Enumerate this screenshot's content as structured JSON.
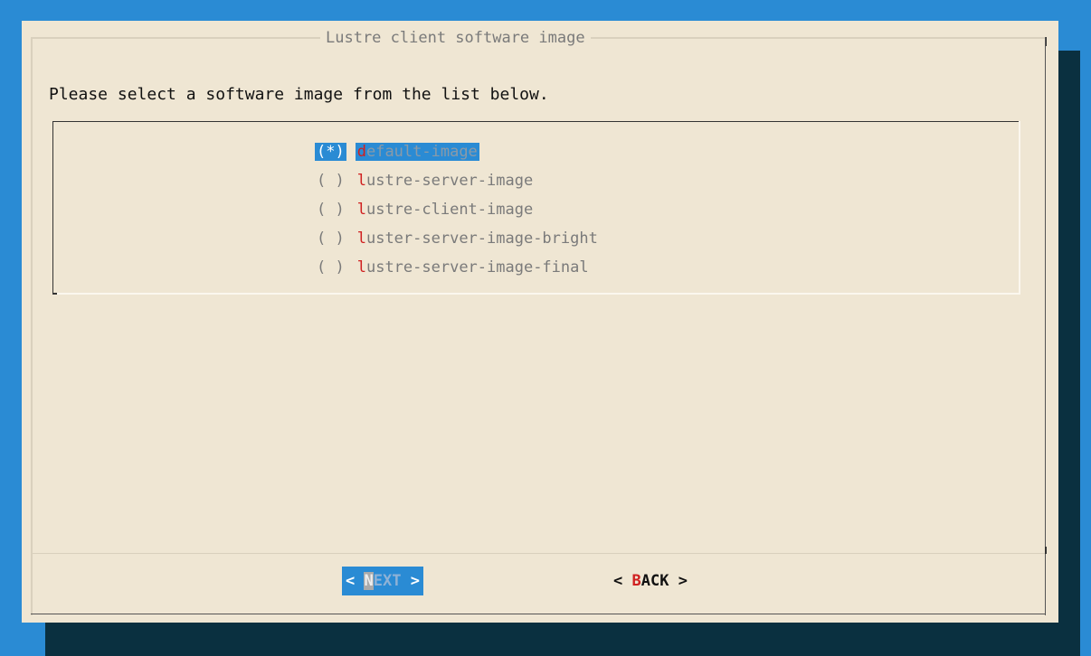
{
  "dialog": {
    "title": "Lustre client software image",
    "prompt": "Please select a software image from the list below."
  },
  "list": {
    "items": [
      {
        "radio": "(*)",
        "hot": "d",
        "rest": "efault-image",
        "selected": true
      },
      {
        "radio": "( )",
        "hot": "l",
        "rest": "ustre-server-image",
        "selected": false
      },
      {
        "radio": "( )",
        "hot": "l",
        "rest": "ustre-client-image",
        "selected": false
      },
      {
        "radio": "( )",
        "hot": "l",
        "rest": "uster-server-image-bright",
        "selected": false
      },
      {
        "radio": "( )",
        "hot": "l",
        "rest": "ustre-server-image-final",
        "selected": false
      }
    ]
  },
  "buttons": {
    "next": {
      "left": "< ",
      "hot": "N",
      "rest": "EXT",
      "right": " >"
    },
    "back": {
      "left": "< ",
      "hot": "B",
      "rest": "ACK",
      "right": " >"
    }
  },
  "colors": {
    "background": "#2a8bd4",
    "dialog": "#efe6d3",
    "shadow": "#0a3040",
    "highlight": "#2a8bd4",
    "hotkey": "#d02020"
  }
}
